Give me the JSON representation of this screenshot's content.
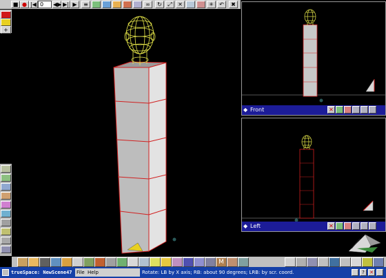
{
  "playback": {
    "frame_value": "0",
    "buttons": [
      "stop",
      "record",
      "go-start",
      "prev-key",
      "frame-input",
      "next-key",
      "go-end"
    ]
  },
  "viewports": {
    "front_label": "Front",
    "left_label": "Left"
  },
  "statusbar": {
    "app_title": "trueSpace: NewScene47",
    "menu_file": "File",
    "menu_help": "Help",
    "hint": "Rotate: LB by X axis; RB: about 90 degrees; LRB: by scr. coord."
  },
  "colors": {
    "wireframe_head": "#e8e84a",
    "pillar_edges": "#d02020",
    "pillar_face": "#c8c8c8",
    "viewport_bar": "#1c1c98",
    "statusbar": "#1540a8"
  }
}
